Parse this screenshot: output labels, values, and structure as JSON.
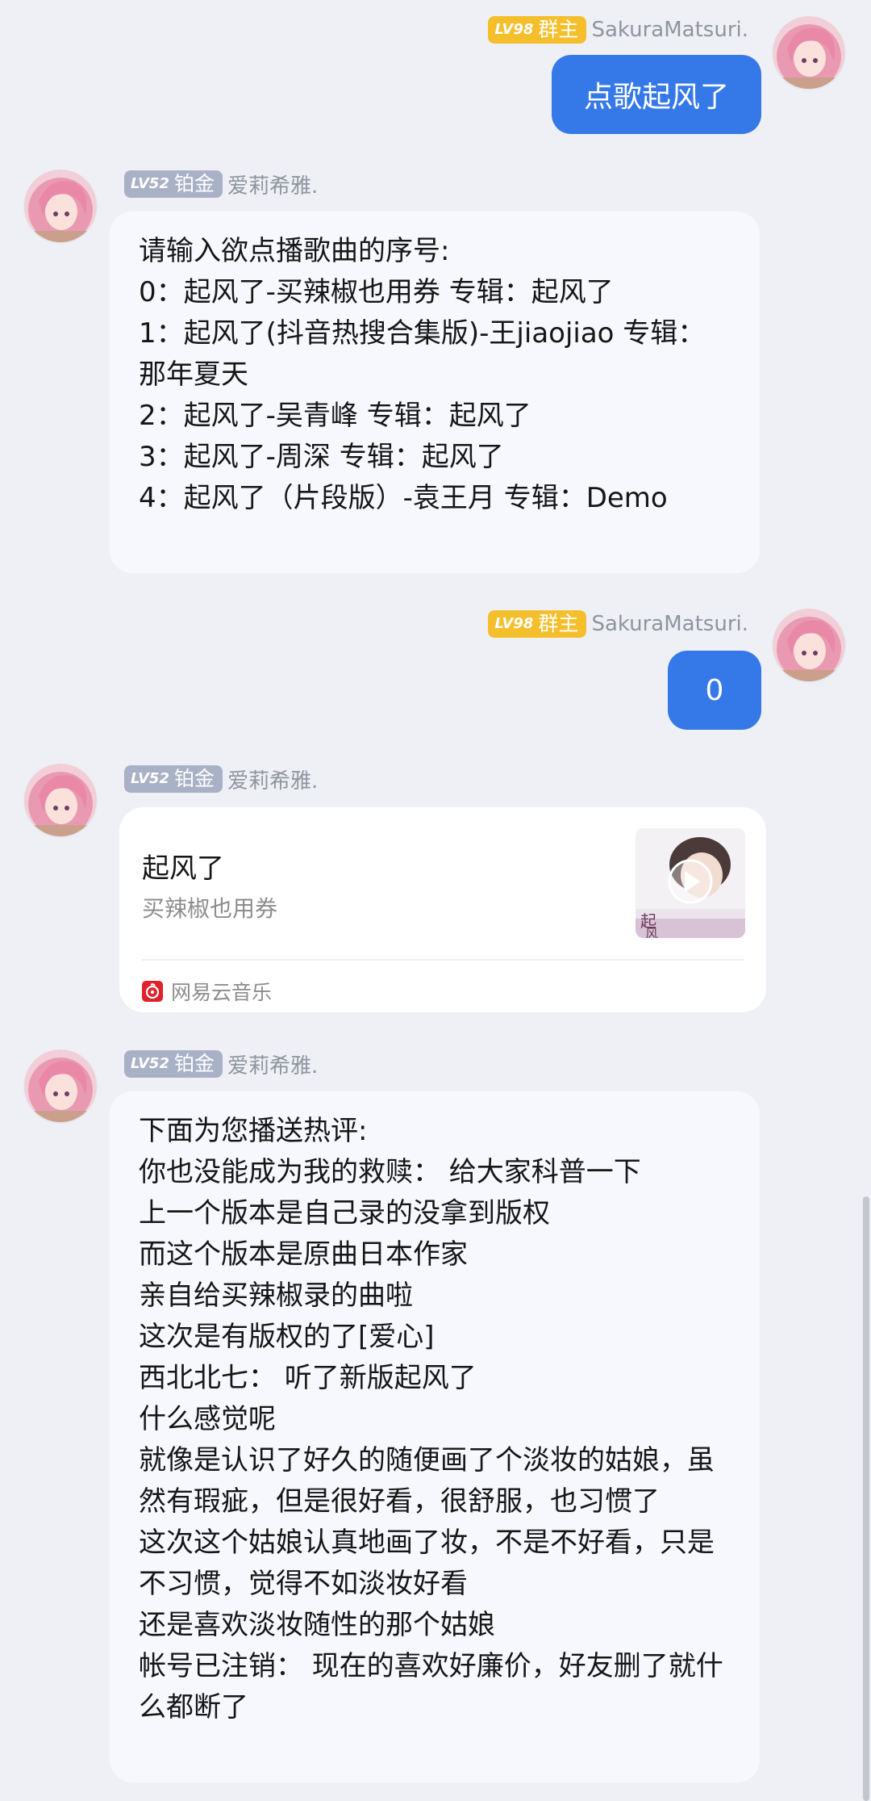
{
  "messages": [
    {
      "sender": {
        "level": "LV98",
        "role": "群主",
        "name": "SakuraMatsuri."
      },
      "text": "点歌起风了"
    },
    {
      "sender": {
        "level": "LV52",
        "role": "铂金",
        "name": "爱莉希雅."
      },
      "lines": [
        "请输入欲点播歌曲的序号:",
        "0：起风了-买辣椒也用券 专辑：起风了",
        "1：起风了(抖音热搜合集版)-王jiaojiao 专辑：那年夏天",
        "2：起风了-吴青峰 专辑：起风了",
        "3：起风了-周深 专辑：起风了",
        "4：起风了（片段版）-袁王月 专辑：Demo"
      ]
    },
    {
      "sender": {
        "level": "LV98",
        "role": "群主",
        "name": "SakuraMatsuri."
      },
      "text": "0"
    },
    {
      "sender": {
        "level": "LV52",
        "role": "铂金",
        "name": "爱莉希雅."
      },
      "card": {
        "title": "起风了",
        "artist": "买辣椒也用券",
        "source": "网易云音乐",
        "cover_text": "起风了"
      }
    },
    {
      "sender": {
        "level": "LV52",
        "role": "铂金",
        "name": "爱莉希雅."
      },
      "lines": [
        "下面为您播送热评:",
        "你也没能成为我的救赎： 给大家科普一下",
        "上一个版本是自己录的没拿到版权",
        "而这个版本是原曲日本作家",
        "亲自给买辣椒录的曲啦",
        "这次是有版权的了[爱心]",
        "西北北七： 听了新版起风了",
        "什么感觉呢",
        "就像是认识了好久的随便画了个淡妆的姑娘，虽然有瑕疵，但是很好看，很舒服，也习惯了",
        "这次这个姑娘认真地画了妆，不是不好看，只是不习惯，觉得不如淡妆好看",
        "还是喜欢淡妆随性的那个姑娘",
        "帐号已注销： 现在的喜欢好廉价，好友删了就什么都断了"
      ]
    }
  ],
  "colors": {
    "background": "#eef0f6",
    "self_bubble": "#3579e8",
    "other_bubble": "#f7f8fe",
    "owner_badge": "#f5be2b",
    "platinum_badge": "#a9b1c6",
    "netease_red": "#e0202a"
  },
  "icons": {
    "avatar": "anime-girl-avatar",
    "play": "play-icon",
    "netease": "netease-music-icon"
  }
}
